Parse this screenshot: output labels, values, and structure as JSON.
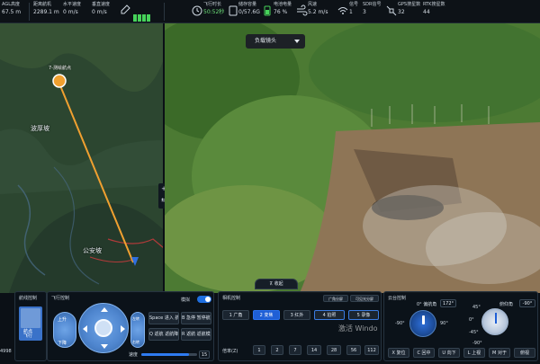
{
  "telemetry": [
    {
      "label": "AGL高度",
      "value": "67.5 m"
    },
    {
      "label": "距离航机",
      "value": "2289.1 m"
    },
    {
      "label": "水平速度",
      "value": "0 m/s"
    },
    {
      "label": "垂直速度",
      "value": "0 m/s"
    },
    {
      "label": "飞行时长",
      "value": "50:52秒"
    },
    {
      "label": "储存容量",
      "value": "0/57.6G"
    },
    {
      "label": "电池电量",
      "value": "76 %"
    },
    {
      "label": "风速",
      "value": "5.2 m/s"
    },
    {
      "label": "信号",
      "value": "1"
    },
    {
      "label": "SDR信号",
      "value": "3"
    },
    {
      "label": "GPS搜星数",
      "value": "32"
    },
    {
      "label": "RTK搜星数",
      "value": "44"
    }
  ],
  "map": {
    "labels": [
      "波厚坡",
      "公安坡"
    ],
    "waypoint_label": "7-测绘航点",
    "zoom_plus": "+",
    "zoom_toggle": "⇆"
  },
  "feed": {
    "lens_select": "负载镜头",
    "watermark": "激活 Windo"
  },
  "handle_tab": "⊼ 收起",
  "route_panel": {
    "title": "航线控制",
    "mode_label": "航点\n飞行"
  },
  "flight_panel": {
    "title": "飞行控制",
    "toggle_label": "模拟",
    "dpad_labels": {
      "up": "上升",
      "down": "下降",
      "left": "左转",
      "right": "右转"
    },
    "actions": [
      {
        "label": "Space 进入 航点继续"
      },
      {
        "label": "B 急停 暂停航行"
      },
      {
        "label": "Q 返航 返航降落"
      },
      {
        "label": "R 返航 返航模式"
      }
    ],
    "speed_label": "速度",
    "speed_value": "15",
    "speed_fraction": 0.85,
    "left_value": "4998"
  },
  "camera_panel": {
    "title": "相机控制",
    "modes": [
      "1 广角",
      "2 变焦",
      "3 红外",
      "4 拍照",
      "5 录像"
    ],
    "active_mode_index": 1,
    "chips": [
      "广角分屏",
      "可见光分屏"
    ],
    "zoom_label": "倍率(Z)",
    "zoom_levels": [
      "1",
      "2",
      "7",
      "14",
      "28",
      "56",
      "112"
    ]
  },
  "gimbal_panel": {
    "title": "云台控制",
    "yaw_label": "0° 偏航角",
    "yaw_value": "172°",
    "pitch_label": "俯仰角",
    "pitch_value": "-90°",
    "ticks_left": [
      "-90°",
      "90°"
    ],
    "ticks_pitch": [
      "45°",
      "0°",
      "-45°",
      "-90°"
    ],
    "actions": [
      "X 复位",
      "C 回中",
      "U 向下",
      "L 上视",
      "M 对于",
      "俯视"
    ]
  }
}
